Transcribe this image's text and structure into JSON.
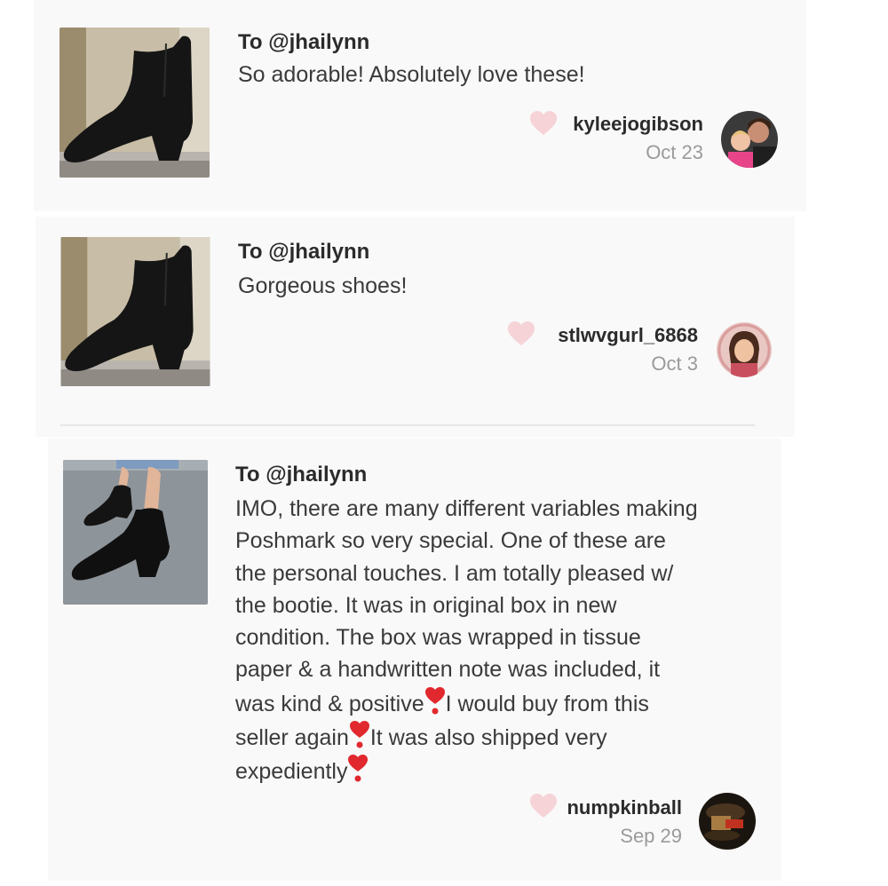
{
  "comments": [
    {
      "to": "To @jhailynn",
      "text": "So adorable! Absolutely love these!",
      "username": "kyleejogibson",
      "date": "Oct 23",
      "thumbnail_icon": "black-ankle-boot-photo",
      "avatar_icon": "user-avatar-photo"
    },
    {
      "to": "To @jhailynn",
      "text": "Gorgeous shoes!",
      "username": "stlwvgurl_6868",
      "date": "Oct 3",
      "thumbnail_icon": "black-ankle-boot-photo",
      "avatar_icon": "user-avatar-photo"
    },
    {
      "to": "To @jhailynn",
      "lines": [
        "IMO, there are many different variables making",
        "Poshmark so very special. One of these are",
        "the personal touches. I am totally pleased w/",
        "the bootie. It was in original box in new",
        "condition. The box was wrapped in tissue",
        "paper & a handwritten note was included, it",
        "was kind & positive",
        "I would buy from this",
        "seller again",
        "It was also shipped very",
        "expediently"
      ],
      "username": "numpkinball",
      "date": "Sep 29",
      "thumbnail_icon": "black-ankle-boot-worn-photo",
      "avatar_icon": "user-avatar-photo",
      "emoji": "red-exclamation-heart"
    }
  ],
  "colors": {
    "card_bg": "#f9f9f9",
    "like_heart": "#f6d3d7",
    "emoji_heart": "#e0282e",
    "date_gray": "#9a9a9a"
  }
}
